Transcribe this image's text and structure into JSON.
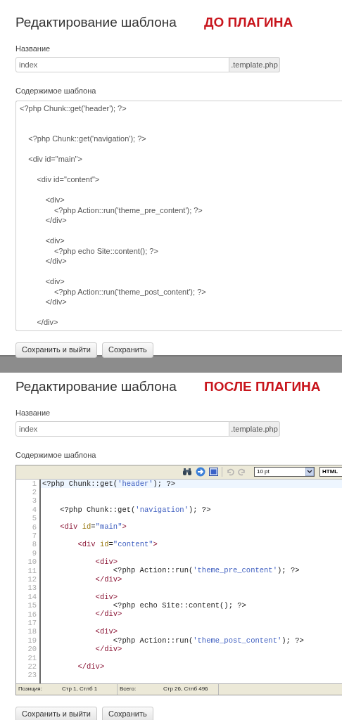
{
  "panels": [
    {
      "title": "Редактирование шаблона",
      "badge": "ДО ПЛАГИНА",
      "name_label": "Название",
      "name_value": "index",
      "name_suffix": ".template.php",
      "content_label": "Содержимое шаблона",
      "editor": {
        "kind": "textarea",
        "content": "<?php Chunk::get('header'); ?>\n\n\n    <?php Chunk::get('navigation'); ?>\n\n    <div id=\"main\">\n\n        <div id=\"content\">\n\n            <div>\n                <?php Action::run('theme_pre_content'); ?>\n            </div>\n\n            <div>\n                <?php echo Site::content(); ?>\n            </div>\n\n            <div>\n                <?php Action::run('theme_post_content'); ?>\n            </div>\n\n        </div>"
      },
      "buttons": [
        "Сохранить и выйти",
        "Сохранить"
      ]
    },
    {
      "title": "Редактирование шаблона",
      "badge": "ПОСЛЕ ПЛАГИНА",
      "name_label": "Название",
      "name_value": "index",
      "name_suffix": ".template.php",
      "content_label": "Содержимое шаблона",
      "editor": {
        "kind": "code",
        "toolbar": [
          {
            "kind": "find",
            "disabled": false
          },
          {
            "kind": "goto",
            "disabled": false
          },
          {
            "kind": "fullscreen",
            "disabled": false
          },
          {
            "kind": "undo",
            "disabled": true
          },
          {
            "kind": "redo",
            "disabled": true
          }
        ],
        "font_size": "10 pt",
        "mode": "HTML",
        "lines": [
          {
            "number": "1",
            "current": true,
            "tokens": [
              {
                "kind": "text",
                "text": "<?php Chunk::get("
              },
              {
                "kind": "string",
                "text": "'header'"
              },
              {
                "kind": "text",
                "text": "); ?>"
              }
            ]
          },
          {
            "number": "2",
            "current": false
          },
          {
            "number": "3",
            "current": false
          },
          {
            "number": "4",
            "current": false,
            "tokens": [
              {
                "kind": "text",
                "text": "    <?php Chunk::get("
              },
              {
                "kind": "string",
                "text": "'navigation'"
              },
              {
                "kind": "text",
                "text": "); ?>"
              }
            ]
          },
          {
            "number": "5",
            "current": false
          },
          {
            "number": "6",
            "current": false,
            "tokens": [
              {
                "kind": "tag",
                "text": "    <div"
              },
              {
                "kind": "attr",
                "text": " id"
              },
              {
                "kind": "text",
                "text": "="
              },
              {
                "kind": "string",
                "text": "\"main\""
              },
              {
                "kind": "tag",
                "text": ">"
              }
            ]
          },
          {
            "number": "7",
            "current": false
          },
          {
            "number": "8",
            "current": false,
            "tokens": [
              {
                "kind": "tag",
                "text": "        <div"
              },
              {
                "kind": "attr",
                "text": " id"
              },
              {
                "kind": "text",
                "text": "="
              },
              {
                "kind": "string",
                "text": "\"content\""
              },
              {
                "kind": "tag",
                "text": ">"
              }
            ]
          },
          {
            "number": "9",
            "current": false
          },
          {
            "number": "10",
            "current": false,
            "tokens": [
              {
                "kind": "tag",
                "text": "            <div>"
              }
            ]
          },
          {
            "number": "11",
            "current": false,
            "tokens": [
              {
                "kind": "text",
                "text": "                <?php Action::run("
              },
              {
                "kind": "string",
                "text": "'theme_pre_content'"
              },
              {
                "kind": "text",
                "text": "); ?>"
              }
            ]
          },
          {
            "number": "12",
            "current": false,
            "tokens": [
              {
                "kind": "tag",
                "text": "            </div>"
              }
            ]
          },
          {
            "number": "13",
            "current": false
          },
          {
            "number": "14",
            "current": false,
            "tokens": [
              {
                "kind": "tag",
                "text": "            <div>"
              }
            ]
          },
          {
            "number": "15",
            "current": false,
            "tokens": [
              {
                "kind": "text",
                "text": "                <?php echo Site::content(); ?>"
              }
            ]
          },
          {
            "number": "16",
            "current": false,
            "tokens": [
              {
                "kind": "tag",
                "text": "            </div>"
              }
            ]
          },
          {
            "number": "17",
            "current": false
          },
          {
            "number": "18",
            "current": false,
            "tokens": [
              {
                "kind": "tag",
                "text": "            <div>"
              }
            ]
          },
          {
            "number": "19",
            "current": false,
            "tokens": [
              {
                "kind": "text",
                "text": "                <?php Action::run("
              },
              {
                "kind": "string",
                "text": "'theme_post_content'"
              },
              {
                "kind": "text",
                "text": "); ?>"
              }
            ]
          },
          {
            "number": "20",
            "current": false,
            "tokens": [
              {
                "kind": "tag",
                "text": "            </div>"
              }
            ]
          },
          {
            "number": "21",
            "current": false
          },
          {
            "number": "22",
            "current": false,
            "tokens": [
              {
                "kind": "tag",
                "text": "        </div>"
              }
            ]
          },
          {
            "number": "23",
            "current": false
          }
        ],
        "status": [
          {
            "label": "Позиция:",
            "value": "Стр 1, Стлб 1"
          },
          {
            "label": "Всего:",
            "value": "Стр 26, Стлб 496"
          }
        ]
      },
      "buttons": [
        "Сохранить и выйти",
        "Сохранить"
      ]
    }
  ]
}
